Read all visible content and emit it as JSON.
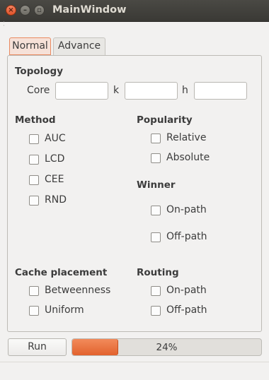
{
  "window": {
    "title": "MainWindow"
  },
  "tabs": [
    {
      "label": "Normal"
    },
    {
      "label": "Advance"
    }
  ],
  "topology": {
    "heading": "Topology",
    "core_label": "Core",
    "core_value": "",
    "k_label": "k",
    "k_value": "",
    "h_label": "h",
    "h_value": ""
  },
  "method": {
    "heading": "Method",
    "options": [
      {
        "label": "AUC",
        "checked": false
      },
      {
        "label": "LCD",
        "checked": false
      },
      {
        "label": "CEE",
        "checked": false
      },
      {
        "label": "RND",
        "checked": false
      }
    ]
  },
  "popularity": {
    "heading": "Popularity",
    "options": [
      {
        "label": "Relative",
        "checked": false
      },
      {
        "label": "Absolute",
        "checked": false
      }
    ]
  },
  "winner": {
    "heading": "Winner",
    "options": [
      {
        "label": "On-path",
        "checked": false
      },
      {
        "label": "Off-path",
        "checked": false
      }
    ]
  },
  "cache_placement": {
    "heading": "Cache placement",
    "options": [
      {
        "label": "Betweenness",
        "checked": false
      },
      {
        "label": "Uniform",
        "checked": false
      }
    ]
  },
  "routing": {
    "heading": "Routing",
    "options": [
      {
        "label": "On-path",
        "checked": false
      },
      {
        "label": "Off-path",
        "checked": false
      }
    ]
  },
  "controls": {
    "run_label": "Run"
  },
  "progress": {
    "value": 24,
    "text": "24%"
  }
}
